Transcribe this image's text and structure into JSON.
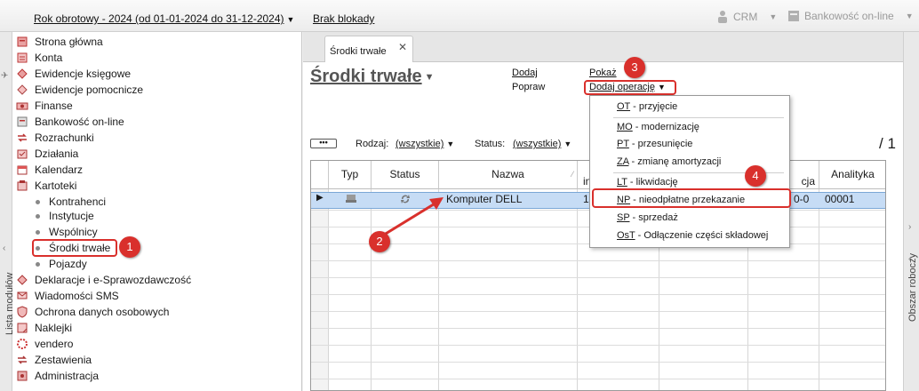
{
  "topbar": {
    "fiscal_year": "Rok obrotowy - 2024  (od 01-01-2024 do 31-12-2024)",
    "lock_status": "Brak blokady",
    "crm_label": "CRM",
    "banking_label": "Bankowość on-line"
  },
  "left_strip": {
    "label": "Lista modułów"
  },
  "right_strip": {
    "label": "Obszar roboczy"
  },
  "nav": {
    "items": [
      {
        "label": "Strona główna",
        "icon": "home-icon"
      },
      {
        "label": "Konta",
        "icon": "accounts-icon"
      },
      {
        "label": "Ewidencje księgowe",
        "icon": "ledger-icon"
      },
      {
        "label": "Ewidencje pomocnicze",
        "icon": "aux-ledger-icon"
      },
      {
        "label": "Finanse",
        "icon": "finance-icon"
      },
      {
        "label": "Bankowość on-line",
        "icon": "bank-icon"
      },
      {
        "label": "Rozrachunki",
        "icon": "settlements-icon"
      },
      {
        "label": "Działania",
        "icon": "actions-icon"
      },
      {
        "label": "Kalendarz",
        "icon": "calendar-icon"
      },
      {
        "label": "Kartoteki",
        "icon": "records-icon"
      },
      {
        "label": "Kontrahenci"
      },
      {
        "label": "Instytucje"
      },
      {
        "label": "Wspólnicy"
      },
      {
        "label": "Środki trwałe"
      },
      {
        "label": "Pojazdy"
      },
      {
        "label": "Deklaracje i e-Sprawozdawczość",
        "icon": "declarations-icon"
      },
      {
        "label": "Wiadomości SMS",
        "icon": "sms-icon"
      },
      {
        "label": "Ochrona danych osobowych",
        "icon": "data-protection-icon"
      },
      {
        "label": "Naklejki",
        "icon": "stickers-icon"
      },
      {
        "label": "vendero",
        "icon": "vendero-icon"
      },
      {
        "label": "Zestawienia",
        "icon": "reports-icon"
      },
      {
        "label": "Administracja",
        "icon": "admin-icon"
      }
    ]
  },
  "tab": {
    "label": "Środki trwałe",
    "close": "✕"
  },
  "page": {
    "title": "Środki trwałe",
    "actions": {
      "dodaj": "Dodaj",
      "popraw": "Popraw",
      "pokaz": "Pokaż",
      "dodaj_operacje": "Dodaj operację"
    },
    "more_button": "•••",
    "filters": {
      "rodzaj_label": "Rodzaj:",
      "rodzaj_value": "(wszystkie)",
      "status_label": "Status:",
      "status_value": "(wszystkie)"
    },
    "count": "/ 1"
  },
  "grid": {
    "columns": [
      "Typ",
      "Status",
      "Nazwa",
      "in",
      "",
      "",
      "cja",
      "Analityka"
    ],
    "rows": [
      {
        "nazwa": "Komputer DELL",
        "nr_prefix": "1",
        "amort": "0-0",
        "analityka": "00001"
      }
    ]
  },
  "menu": {
    "items": [
      {
        "key": "OT",
        "rest": " - przyjęcie"
      },
      {
        "key": "MO",
        "rest": " - modernizację"
      },
      {
        "key": "PT",
        "rest": " - przesunięcie"
      },
      {
        "key": "ZA",
        "rest": " - zmianę amortyzacji"
      },
      {
        "key": "LT",
        "rest": " - likwidację"
      },
      {
        "key": "NP",
        "rest": " - nieodpłatne przekazanie"
      },
      {
        "key": "SP",
        "rest": " - sprzedaż"
      },
      {
        "key": "OsT",
        "rest": " - Odłączenie części składowej"
      }
    ]
  },
  "annotations": [
    "1",
    "2",
    "3",
    "4"
  ],
  "colors": {
    "accent_red": "#d9302c",
    "selected_row": "#c6dcf5"
  }
}
